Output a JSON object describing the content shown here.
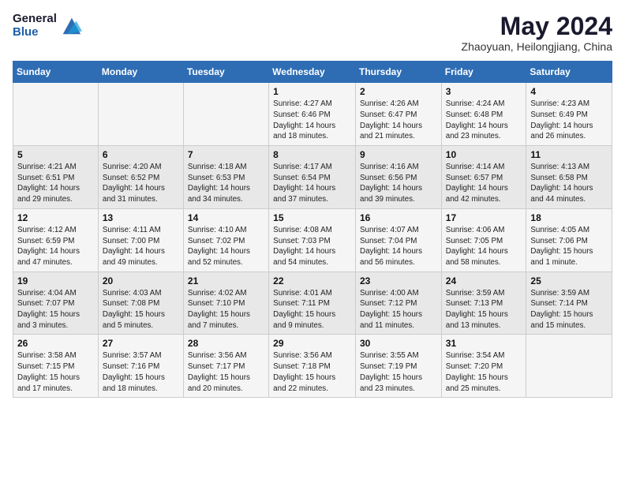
{
  "header": {
    "logo_general": "General",
    "logo_blue": "Blue",
    "month_title": "May 2024",
    "location": "Zhaoyuan, Heilongjiang, China"
  },
  "days_of_week": [
    "Sunday",
    "Monday",
    "Tuesday",
    "Wednesday",
    "Thursday",
    "Friday",
    "Saturday"
  ],
  "weeks": [
    [
      {
        "num": "",
        "info": ""
      },
      {
        "num": "",
        "info": ""
      },
      {
        "num": "",
        "info": ""
      },
      {
        "num": "1",
        "info": "Sunrise: 4:27 AM\nSunset: 6:46 PM\nDaylight: 14 hours\nand 18 minutes."
      },
      {
        "num": "2",
        "info": "Sunrise: 4:26 AM\nSunset: 6:47 PM\nDaylight: 14 hours\nand 21 minutes."
      },
      {
        "num": "3",
        "info": "Sunrise: 4:24 AM\nSunset: 6:48 PM\nDaylight: 14 hours\nand 23 minutes."
      },
      {
        "num": "4",
        "info": "Sunrise: 4:23 AM\nSunset: 6:49 PM\nDaylight: 14 hours\nand 26 minutes."
      }
    ],
    [
      {
        "num": "5",
        "info": "Sunrise: 4:21 AM\nSunset: 6:51 PM\nDaylight: 14 hours\nand 29 minutes."
      },
      {
        "num": "6",
        "info": "Sunrise: 4:20 AM\nSunset: 6:52 PM\nDaylight: 14 hours\nand 31 minutes."
      },
      {
        "num": "7",
        "info": "Sunrise: 4:18 AM\nSunset: 6:53 PM\nDaylight: 14 hours\nand 34 minutes."
      },
      {
        "num": "8",
        "info": "Sunrise: 4:17 AM\nSunset: 6:54 PM\nDaylight: 14 hours\nand 37 minutes."
      },
      {
        "num": "9",
        "info": "Sunrise: 4:16 AM\nSunset: 6:56 PM\nDaylight: 14 hours\nand 39 minutes."
      },
      {
        "num": "10",
        "info": "Sunrise: 4:14 AM\nSunset: 6:57 PM\nDaylight: 14 hours\nand 42 minutes."
      },
      {
        "num": "11",
        "info": "Sunrise: 4:13 AM\nSunset: 6:58 PM\nDaylight: 14 hours\nand 44 minutes."
      }
    ],
    [
      {
        "num": "12",
        "info": "Sunrise: 4:12 AM\nSunset: 6:59 PM\nDaylight: 14 hours\nand 47 minutes."
      },
      {
        "num": "13",
        "info": "Sunrise: 4:11 AM\nSunset: 7:00 PM\nDaylight: 14 hours\nand 49 minutes."
      },
      {
        "num": "14",
        "info": "Sunrise: 4:10 AM\nSunset: 7:02 PM\nDaylight: 14 hours\nand 52 minutes."
      },
      {
        "num": "15",
        "info": "Sunrise: 4:08 AM\nSunset: 7:03 PM\nDaylight: 14 hours\nand 54 minutes."
      },
      {
        "num": "16",
        "info": "Sunrise: 4:07 AM\nSunset: 7:04 PM\nDaylight: 14 hours\nand 56 minutes."
      },
      {
        "num": "17",
        "info": "Sunrise: 4:06 AM\nSunset: 7:05 PM\nDaylight: 14 hours\nand 58 minutes."
      },
      {
        "num": "18",
        "info": "Sunrise: 4:05 AM\nSunset: 7:06 PM\nDaylight: 15 hours\nand 1 minute."
      }
    ],
    [
      {
        "num": "19",
        "info": "Sunrise: 4:04 AM\nSunset: 7:07 PM\nDaylight: 15 hours\nand 3 minutes."
      },
      {
        "num": "20",
        "info": "Sunrise: 4:03 AM\nSunset: 7:08 PM\nDaylight: 15 hours\nand 5 minutes."
      },
      {
        "num": "21",
        "info": "Sunrise: 4:02 AM\nSunset: 7:10 PM\nDaylight: 15 hours\nand 7 minutes."
      },
      {
        "num": "22",
        "info": "Sunrise: 4:01 AM\nSunset: 7:11 PM\nDaylight: 15 hours\nand 9 minutes."
      },
      {
        "num": "23",
        "info": "Sunrise: 4:00 AM\nSunset: 7:12 PM\nDaylight: 15 hours\nand 11 minutes."
      },
      {
        "num": "24",
        "info": "Sunrise: 3:59 AM\nSunset: 7:13 PM\nDaylight: 15 hours\nand 13 minutes."
      },
      {
        "num": "25",
        "info": "Sunrise: 3:59 AM\nSunset: 7:14 PM\nDaylight: 15 hours\nand 15 minutes."
      }
    ],
    [
      {
        "num": "26",
        "info": "Sunrise: 3:58 AM\nSunset: 7:15 PM\nDaylight: 15 hours\nand 17 minutes."
      },
      {
        "num": "27",
        "info": "Sunrise: 3:57 AM\nSunset: 7:16 PM\nDaylight: 15 hours\nand 18 minutes."
      },
      {
        "num": "28",
        "info": "Sunrise: 3:56 AM\nSunset: 7:17 PM\nDaylight: 15 hours\nand 20 minutes."
      },
      {
        "num": "29",
        "info": "Sunrise: 3:56 AM\nSunset: 7:18 PM\nDaylight: 15 hours\nand 22 minutes."
      },
      {
        "num": "30",
        "info": "Sunrise: 3:55 AM\nSunset: 7:19 PM\nDaylight: 15 hours\nand 23 minutes."
      },
      {
        "num": "31",
        "info": "Sunrise: 3:54 AM\nSunset: 7:20 PM\nDaylight: 15 hours\nand 25 minutes."
      },
      {
        "num": "",
        "info": ""
      }
    ]
  ]
}
